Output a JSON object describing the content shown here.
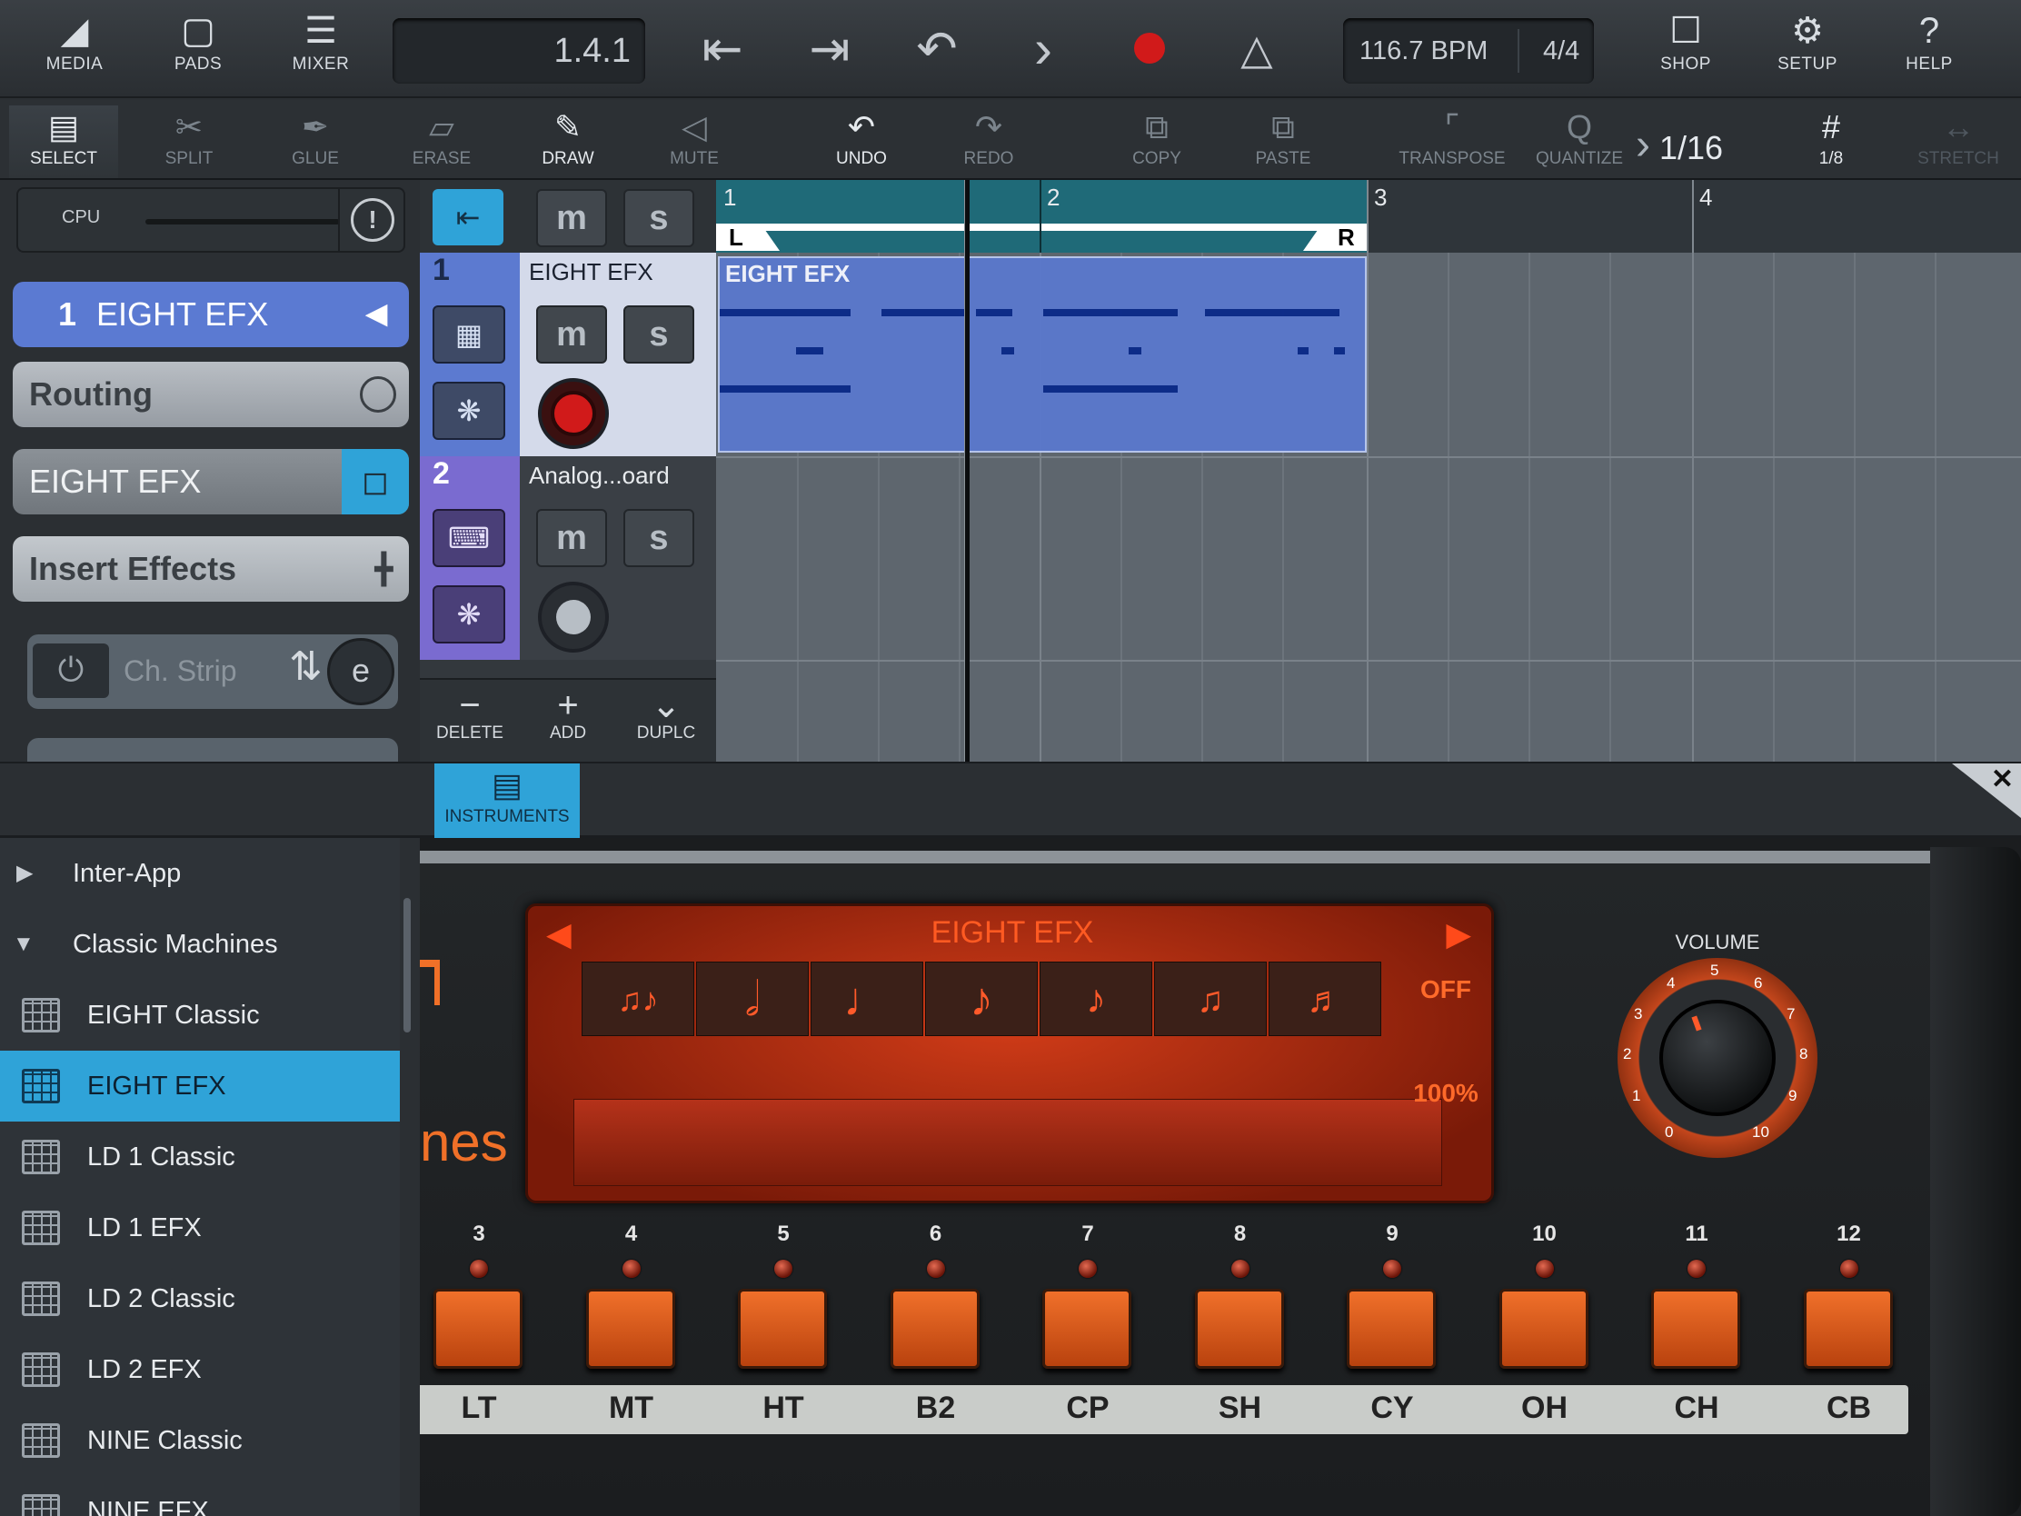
{
  "topbar": {
    "media": "MEDIA",
    "pads": "PADS",
    "mixer": "MIXER",
    "position": "1.4.1",
    "tempo": "116.7 BPM",
    "signature": "4/4",
    "shop": "SHOP",
    "setup": "SETUP",
    "help": "HELP"
  },
  "toolbar": {
    "select": "SELECT",
    "split": "SPLIT",
    "glue": "GLUE",
    "erase": "ERASE",
    "draw": "DRAW",
    "mute": "MUTE",
    "undo": "UNDO",
    "redo": "REDO",
    "copy": "COPY",
    "paste": "PASTE",
    "transpose": "TRANSPOSE",
    "quantize": "QUANTIZE",
    "quantize_value": "1/16",
    "grid_value": "1/8",
    "stretch": "STRETCH"
  },
  "inspector": {
    "cpu": "CPU",
    "track_number": "1",
    "track_name": "EIGHT EFX",
    "routing": "Routing",
    "instrument": "EIGHT EFX",
    "insert_effects": "Insert Effects",
    "effect_slot": "Ch. Strip"
  },
  "tracks": [
    {
      "number": "1",
      "name": "EIGHT EFX",
      "m": "m",
      "s": "s"
    },
    {
      "number": "2",
      "name": "Analog...oard",
      "m": "m",
      "s": "s"
    }
  ],
  "track_actions": {
    "delete": "DELETE",
    "add": "ADD",
    "duplicate": "DUPLC"
  },
  "ruler": {
    "bars": [
      "1",
      "2",
      "3",
      "4"
    ],
    "left_locator": "L",
    "right_locator": "R"
  },
  "clip": {
    "name": "EIGHT EFX"
  },
  "panel": {
    "tab": "INSTRUMENTS"
  },
  "browser": {
    "items": [
      {
        "label": "Inter-App",
        "kind": "folder"
      },
      {
        "label": "Classic Machines",
        "kind": "folder"
      },
      {
        "label": "EIGHT Classic",
        "kind": "instrument"
      },
      {
        "label": "EIGHT EFX",
        "kind": "instrument"
      },
      {
        "label": "LD 1 Classic",
        "kind": "instrument"
      },
      {
        "label": "LD 1 EFX",
        "kind": "instrument"
      },
      {
        "label": "LD 2 Classic",
        "kind": "instrument"
      },
      {
        "label": "LD 2 EFX",
        "kind": "instrument"
      },
      {
        "label": "NINE Classic",
        "kind": "instrument"
      },
      {
        "label": "NINE EFX",
        "kind": "instrument"
      }
    ]
  },
  "instrument": {
    "logo_fragment": "nes",
    "display_title": "EIGHT EFX",
    "repeat_off": "OFF",
    "amount": "100%",
    "volume_label": "VOLUME",
    "volume_scale": [
      "0",
      "1",
      "2",
      "3",
      "4",
      "5",
      "6",
      "7",
      "8",
      "9",
      "10"
    ],
    "pads": [
      {
        "num": "3",
        "name": "LT"
      },
      {
        "num": "4",
        "name": "MT"
      },
      {
        "num": "5",
        "name": "HT"
      },
      {
        "num": "6",
        "name": "B2"
      },
      {
        "num": "7",
        "name": "CP"
      },
      {
        "num": "8",
        "name": "SH"
      },
      {
        "num": "9",
        "name": "CY"
      },
      {
        "num": "10",
        "name": "OH"
      },
      {
        "num": "11",
        "name": "CH"
      },
      {
        "num": "12",
        "name": "CB"
      }
    ]
  },
  "colors": {
    "accent": "#2fa3d8",
    "track1": "#5c7ad0",
    "track2": "#7a6bd0",
    "clip": "#5a78cc",
    "display": "#c8381a",
    "record": "#d11a1a"
  }
}
